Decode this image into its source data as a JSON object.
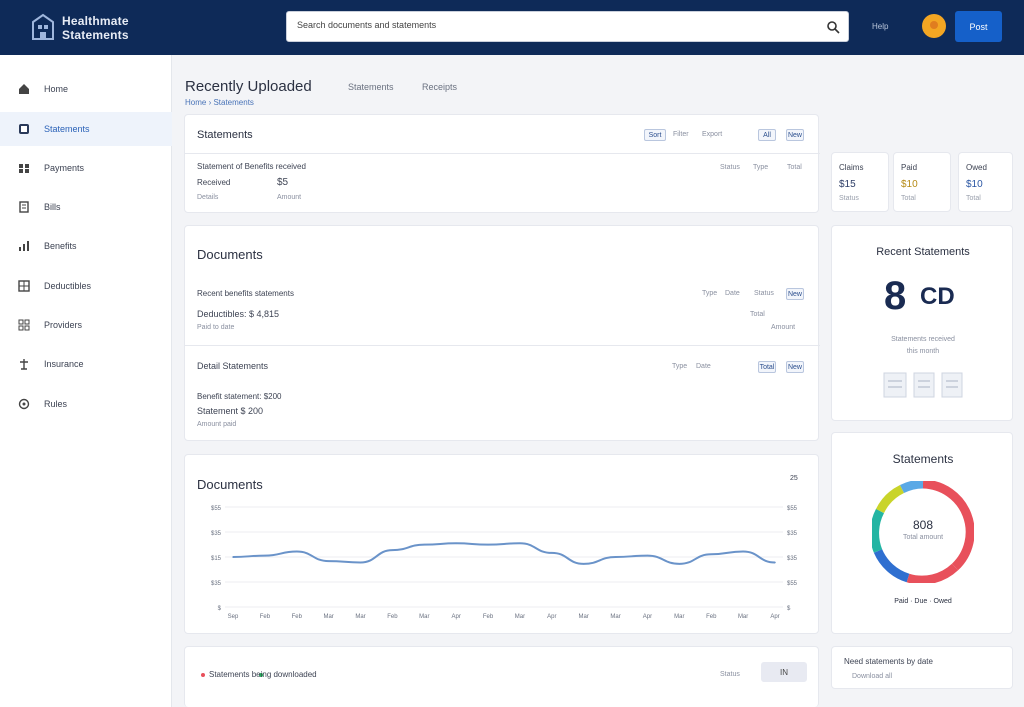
{
  "header": {
    "logo_line1": "Healthmate",
    "logo_line2": "Statements",
    "search_value": "Search documents and statements",
    "link": "Help",
    "button": "Post"
  },
  "sidebar": {
    "items": [
      {
        "label": "Home",
        "icon": "home-icon"
      },
      {
        "label": "Statements",
        "icon": "statements-icon"
      },
      {
        "label": "Payments",
        "icon": "payments-icon"
      },
      {
        "label": "Bills",
        "icon": "bills-icon"
      },
      {
        "label": "Benefits",
        "icon": "benefits-icon"
      },
      {
        "label": "Deductibles",
        "icon": "deductibles-icon"
      },
      {
        "label": "Providers",
        "icon": "providers-icon"
      },
      {
        "label": "Insurance",
        "icon": "insurance-icon"
      },
      {
        "label": "Rules",
        "icon": "rules-icon"
      }
    ]
  },
  "page": {
    "title": "Recently Uploaded",
    "tabs": [
      "Statements",
      "Receipts"
    ],
    "breadcrumb": "Home › Statements"
  },
  "accounts_card": {
    "title": "Statements",
    "actions": [
      "Sort",
      "Filter",
      "Export",
      "All",
      "New"
    ],
    "row": {
      "heading": "Statement of Benefits received",
      "line1": "Received",
      "value1": "$5",
      "sub1": "Details",
      "sub2": "Amount",
      "cols": [
        "Status",
        "Type",
        "Total"
      ]
    }
  },
  "mini_cards": [
    {
      "title": "Claims",
      "value": "$15",
      "sub": "Status"
    },
    {
      "title": "Paid",
      "value": "$10",
      "sub": "Total"
    },
    {
      "title": "Owed",
      "value": "$10",
      "sub": "Total"
    }
  ],
  "documents_card": {
    "title": "Documents",
    "section1": {
      "heading": "Recent benefits statements",
      "line": "Deductibles: $ 4,815",
      "sub": "Paid to date",
      "cols": [
        "Type",
        "Date",
        "Status",
        "New"
      ],
      "sub_cols": [
        "Total",
        "Amount"
      ]
    },
    "section2": {
      "heading": "Detail Statements",
      "line1": "Benefit statement: $200",
      "line2": "Statement $ 200",
      "sub": "Amount paid",
      "cols": [
        "Type",
        "Date",
        "Total",
        "New"
      ]
    }
  },
  "stat_card": {
    "title": "Recent Statements",
    "big_value": "8",
    "big_suffix": "CD",
    "caption1": "Statements received",
    "caption2": "this month"
  },
  "timeline_card": {
    "title": "Documents",
    "corner": "25"
  },
  "donut_card": {
    "title": "Statements",
    "center_value": "808",
    "center_label": "Total amount",
    "legend": "Paid · Due · Owed"
  },
  "footer": {
    "left_text": "Statements being downloaded",
    "right_text": "Status",
    "button": "IN",
    "side_title": "Need statements by date",
    "side_sub": "Download all"
  },
  "colors": {
    "header_bg": "#0e2a58",
    "accent": "#1560c9",
    "line": "#6a93c9",
    "donut": [
      "#e8505b",
      "#f3a623",
      "#2f6fd0",
      "#23b5a3",
      "#c9d42a"
    ]
  },
  "chart_data": {
    "type": "line",
    "title": "Documents",
    "x": [
      "Sep",
      "Feb",
      "Feb",
      "Mar",
      "Mar",
      "Feb",
      "Mar",
      "Apr",
      "Feb",
      "Mar",
      "Apr",
      "Mar",
      "Mar",
      "Apr",
      "Mar",
      "Feb",
      "Mar",
      "Apr"
    ],
    "series": [
      {
        "values": [
          525,
          526,
          529,
          522,
          521,
          530,
          534,
          535,
          534,
          535,
          528,
          520,
          525,
          526,
          520,
          527,
          529,
          521
        ]
      }
    ],
    "y_ticks_left": [
      "$55",
      "$35",
      "$15",
      "$35",
      "$"
    ],
    "y_ticks_right": [
      "$55",
      "$35",
      "$35",
      "$55",
      "$"
    ],
    "ylim": [
      490,
      560
    ],
    "grid": true
  }
}
